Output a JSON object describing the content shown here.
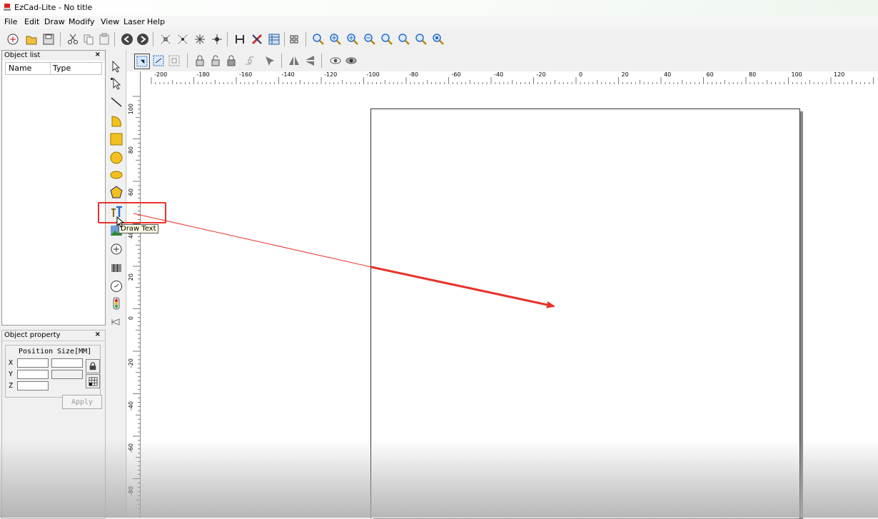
{
  "window": {
    "title": "EzCad-Lite  - No title"
  },
  "menu": [
    "File",
    "Edit",
    "Draw",
    "Modify",
    "View",
    "Laser",
    "Help"
  ],
  "object_list": {
    "title": "Object list",
    "close": "×",
    "col_name": "Name",
    "col_type": "Type"
  },
  "object_property": {
    "title": "Object property",
    "close": "×",
    "position_label": "Position",
    "size_label": "Size[MM]",
    "x_label": "X",
    "y_label": "Y",
    "z_label": "Z",
    "apply_label": "Apply"
  },
  "ruler": {
    "h_labels": [
      "-200",
      "-180",
      "-160",
      "-140",
      "-120",
      "-100",
      "-80",
      "-60",
      "-40",
      "-20",
      "0",
      "20",
      "40",
      "60",
      "80",
      "100",
      "120"
    ],
    "v_labels": [
      "100",
      "80",
      "60",
      "40",
      "20",
      "0",
      "-20",
      "-40",
      "-60",
      "-80"
    ]
  },
  "tooltip": {
    "text": "Draw Text"
  },
  "colors": {
    "annotation": "#e8322a",
    "accent_blue": "#2a6fc9"
  }
}
